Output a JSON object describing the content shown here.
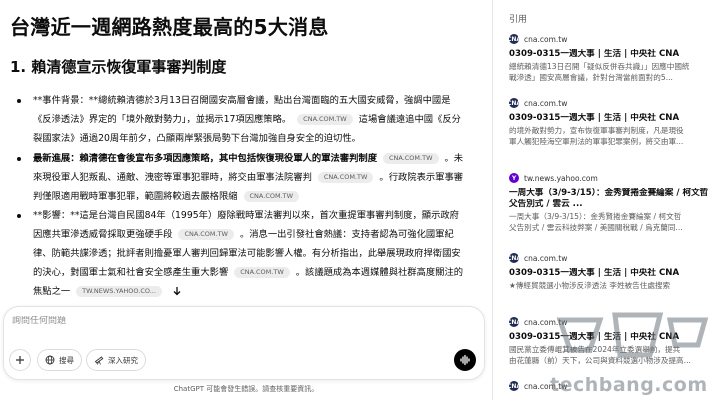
{
  "main": {
    "title": "台灣近一週網路熱度最高的5大消息",
    "section_heading": "1. 賴清德宣示恢復軍事審判制度",
    "bullets": [
      {
        "lead": "**事件背景：**總統賴清德於3月13日召開國安高層會議，點出台灣面臨的五大國安威脅，強調中國是《反滲透法》界定的「境外敵對勢力」，並揭示17項因應策略。",
        "cite": "CNA.COM.TW",
        "tail": "這場會議遠追中國《反分裂國家法》通過20周年前夕，凸顯兩岸緊張局勢下台灣加強自身安全的迫切性。"
      },
      {
        "lead_bold": "最新進展：賴清德在會後宣布多項因應策略，其中包括恢復現役軍人的軍法審判制度",
        "cite1": "CNA.COM.TW",
        "mid": "。未來現役軍人犯叛亂、通敵、洩密等軍事犯罪時，將交由軍事法院審判",
        "cite2": "CNA.COM.TW",
        "tail": "。行政院表示軍事審判僅限適用戰時軍事犯罪，範圍將較過去嚴格限縮",
        "cite3": "CNA.COM.TW"
      },
      {
        "lead": "**影響：**這是台灣自民國84年（1995年）廢除戰時軍法審判以來，首次重提軍事審判制度，顯示政府因應共軍滲透威脅採取更強硬手段",
        "cite1": "CNA.COM.TW",
        "mid": "。消息一出引發社會熱議：支持者認為可強化國軍紀律、防範共諜滲透；批評者則擔憂軍人審判回歸軍法可能影響人權。有分析指出，此舉展現政府捍衛國安的決心，對國軍士氣和社會安全感產生重大影響",
        "cite2": "CNA.COM.TW",
        "tail": "。該議題成為本週媒體與社群高度關注的焦點之一",
        "cite3": "TW.NEWS.YAHOO.CO..."
      }
    ]
  },
  "composer": {
    "placeholder": "詢問任何問題",
    "search_label": "搜尋",
    "research_label": "深入研究"
  },
  "footer_note": "ChatGPT 可能會發生錯誤。請查核重要資訊。",
  "sidebar": {
    "title": "引用",
    "refs": [
      {
        "source": "cna.com.tw",
        "favicon": "CNA",
        "title": "0309-0315一週大事 | 生活 | 中央社 CNA",
        "snippet": [
          "總統賴清德13日召開「疑似反併吞共識」」因應中國統",
          "戰滲透」國安高層會議，針對台灣當前面對的5..."
        ]
      },
      {
        "source": "cna.com.tw",
        "favicon": "CNA",
        "title": "0309-0315一週大事 | 生活 | 中央社 CNA",
        "snippet": [
          "的境外敵對勢力，宣布恢復軍事審判制度，凡是現役",
          "軍人觸犯陸海空軍刑法的軍事犯罪案例，將交由軍..."
        ]
      },
      {
        "source": "tw.news.yahoo.com",
        "favicon": "Y",
        "title": "一周大事（3/9-3/15）：金秀賢捲金賽綸案 / 柯文哲",
        "title2": "父告別式 / 雲云 ...",
        "snippet": [
          "一周大事（3/9-3/15）：金秀賢捲金賽綸案 / 柯文哲",
          "父告別式 / 雲云科技弊案 / 美國關稅戰 / 烏克蘭同..."
        ]
      },
      {
        "source": "cna.com.tw",
        "favicon": "CNA",
        "title": "0309-0315一週大事 | 生活 | 中央社 CNA",
        "snippet": [
          "★傳經貿競選小物涉反滲透法 李姓被告住處搜索"
        ]
      },
      {
        "source": "cna.com.tw",
        "favicon": "CNA",
        "title": "0309-0315一週大事 | 生活 | 中央社 CNA",
        "snippet": [
          "國民黨立委傅崐萁被告在2024年立委選舉前，提共",
          "由花蓮縣（前）天下，公司與資料競選小物涉及提高..."
        ]
      },
      {
        "source": "cna.com.tw",
        "favicon": "CNA",
        "title": "",
        "snippet": []
      }
    ]
  },
  "watermark": "techbang.com"
}
